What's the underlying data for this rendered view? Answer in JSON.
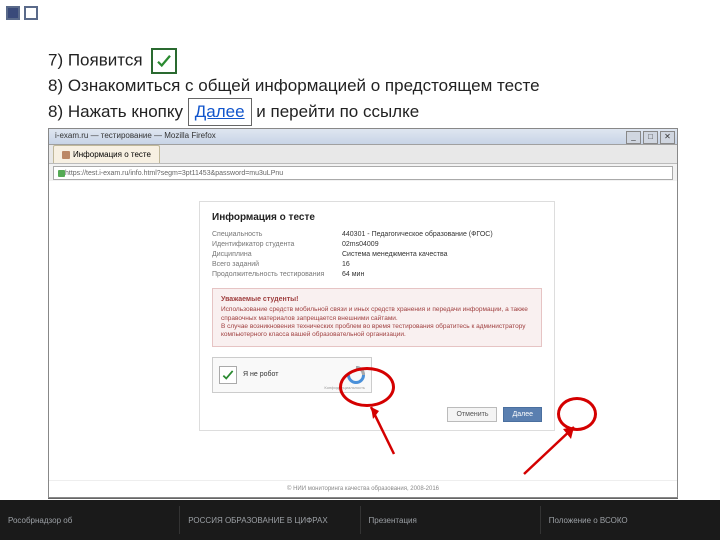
{
  "decor": {},
  "instructions": {
    "line1_prefix": "7) Появится",
    "line2": "8) Ознакомиться с общей информацией о предстоящем тесте",
    "line3_prefix": "8) Нажать кнопку",
    "link_label": "Далее",
    "line3_suffix": "и перейти по ссылке"
  },
  "browser": {
    "title": "i-exam.ru — тестирование — Mozilla Firefox",
    "tab_label": "Информация о тесте",
    "url": "https://test.i-exam.ru/info.html?segm=3pt11453&password=mu3uLPnu",
    "win_min": "_",
    "win_max": "□",
    "win_close": "✕"
  },
  "card": {
    "heading": "Информация о тесте",
    "rows": [
      {
        "label": "Специальность",
        "value": "440301 - Педагогическое образование (ФГОС)"
      },
      {
        "label": "Идентификатор студента",
        "value": "02ms04009"
      },
      {
        "label": "Дисциплина",
        "value": "Система менеджмента качества"
      },
      {
        "label": "Всего заданий",
        "value": "16"
      },
      {
        "label": "Продолжительность тестирования",
        "value": "64 мин"
      }
    ],
    "alert_title": "Уважаемые студенты!",
    "alert_body1": "Использование средств мобильной связи и иных средств хранения и передачи информации, а также справочных материалов запрещается внешними сайтами.",
    "alert_body2": "В случае возникновения технических проблем во время тестирования обратитесь к администратору компьютерного класса вашей образовательной организации."
  },
  "captcha": {
    "label": "Я не робот",
    "provider": "reCAPTCHA",
    "sub": "Конфиденциальность"
  },
  "actions": {
    "back": "Отменить",
    "next": "Далее"
  },
  "footer": "© НИИ мониторинга качества образования, 2008-2016",
  "strip": {
    "c1a": "Рособрнадзор об",
    "c2a": "РОССИЯ ОБРАЗОВАНИЕ В ЦИФРАХ",
    "c3a": "Презентация",
    "c4a": "Положение о ВСОКО"
  }
}
